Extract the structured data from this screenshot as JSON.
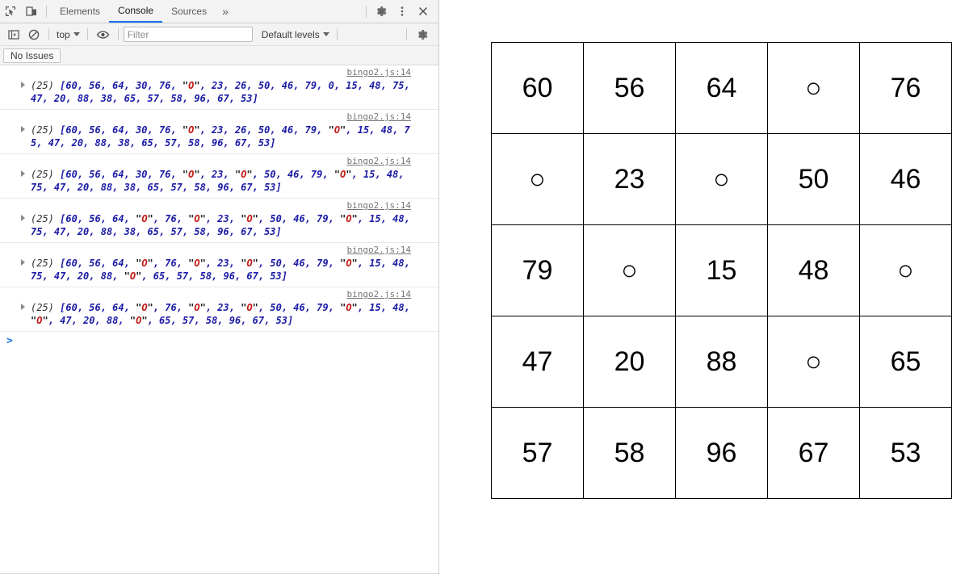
{
  "devtools": {
    "tabs": [
      {
        "label": "Elements",
        "active": false
      },
      {
        "label": "Console",
        "active": true
      },
      {
        "label": "Sources",
        "active": false
      }
    ],
    "more_tabs_label": "»",
    "tabstrip_icons": {
      "inspect": "inspect-element-icon",
      "device": "device-toolbar-icon",
      "settings": "gear-icon",
      "kebab": "more-options-icon",
      "close": "close-icon"
    },
    "console_toolbar": {
      "sidebar_toggle": "console-sidebar-icon",
      "clear": "clear-console-icon",
      "context_label": "top",
      "eye": "live-expression-icon",
      "filter_placeholder": "Filter",
      "filter_value": "",
      "levels_label": "Default levels",
      "settings": "gear-icon"
    },
    "issues_bar": {
      "label": "No Issues"
    },
    "prompt": {
      "caret": ">"
    },
    "log_entries": [
      {
        "count": "(25)",
        "source": "bingo2.js:14",
        "items": [
          "60",
          "56",
          "64",
          "30",
          "76",
          "\"O\"",
          "23",
          "26",
          "50",
          "46",
          "79",
          "0",
          "15",
          "48",
          "75",
          "47",
          "20",
          "88",
          "38",
          "65",
          "57",
          "58",
          "96",
          "67",
          "53"
        ]
      },
      {
        "count": "(25)",
        "source": "bingo2.js:14",
        "items": [
          "60",
          "56",
          "64",
          "30",
          "76",
          "\"O\"",
          "23",
          "26",
          "50",
          "46",
          "79",
          "\"O\"",
          "15",
          "48",
          "75",
          "47",
          "20",
          "88",
          "38",
          "65",
          "57",
          "58",
          "96",
          "67",
          "53"
        ]
      },
      {
        "count": "(25)",
        "source": "bingo2.js:14",
        "items": [
          "60",
          "56",
          "64",
          "30",
          "76",
          "\"O\"",
          "23",
          "\"O\"",
          "50",
          "46",
          "79",
          "\"O\"",
          "15",
          "48",
          "75",
          "47",
          "20",
          "88",
          "38",
          "65",
          "57",
          "58",
          "96",
          "67",
          "53"
        ]
      },
      {
        "count": "(25)",
        "source": "bingo2.js:14",
        "items": [
          "60",
          "56",
          "64",
          "\"O\"",
          "76",
          "\"O\"",
          "23",
          "\"O\"",
          "50",
          "46",
          "79",
          "\"O\"",
          "15",
          "48",
          "75",
          "47",
          "20",
          "88",
          "38",
          "65",
          "57",
          "58",
          "96",
          "67",
          "53"
        ]
      },
      {
        "count": "(25)",
        "source": "bingo2.js:14",
        "items": [
          "60",
          "56",
          "64",
          "\"O\"",
          "76",
          "\"O\"",
          "23",
          "\"O\"",
          "50",
          "46",
          "79",
          "\"O\"",
          "15",
          "48",
          "75",
          "47",
          "20",
          "88",
          "\"O\"",
          "65",
          "57",
          "58",
          "96",
          "67",
          "53"
        ]
      },
      {
        "count": "(25)",
        "source": "bingo2.js:14",
        "items": [
          "60",
          "56",
          "64",
          "\"O\"",
          "76",
          "\"O\"",
          "23",
          "\"O\"",
          "50",
          "46",
          "79",
          "\"O\"",
          "15",
          "48",
          "\"O\"",
          "47",
          "20",
          "88",
          "\"O\"",
          "65",
          "57",
          "58",
          "96",
          "67",
          "53"
        ]
      }
    ]
  },
  "bingo": {
    "marker_glyph": "○",
    "rows": [
      [
        "60",
        "56",
        "64",
        "○",
        "76"
      ],
      [
        "○",
        "23",
        "○",
        "50",
        "46"
      ],
      [
        "79",
        "○",
        "15",
        "48",
        "○"
      ],
      [
        "47",
        "20",
        "88",
        "○",
        "65"
      ],
      [
        "57",
        "58",
        "96",
        "67",
        "53"
      ]
    ]
  },
  "colors": {
    "accent": "#1a73e8",
    "number_blue": "#1a1aa6",
    "string_red": "#c41a16",
    "toolbar_bg": "#f3f3f3",
    "grid_line": "#000000"
  }
}
